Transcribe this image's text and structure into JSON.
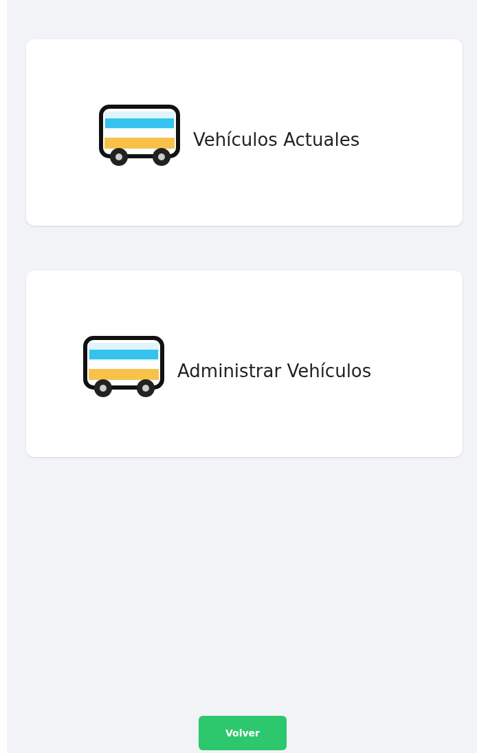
{
  "cards": [
    {
      "label": "Vehículos Actuales"
    },
    {
      "label": "Administrar Vehículos"
    }
  ],
  "back_button": {
    "label": "Volver"
  }
}
